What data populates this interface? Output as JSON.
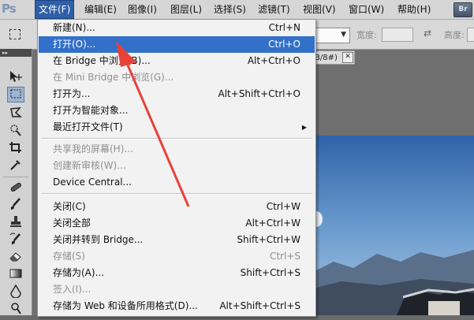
{
  "app": {
    "logo": "Ps",
    "bridge_button": "Br"
  },
  "menubar": {
    "items": [
      {
        "label": "文件(F)",
        "active": true
      },
      {
        "label": "编辑(E)"
      },
      {
        "label": "图像(I)"
      },
      {
        "label": "图层(L)"
      },
      {
        "label": "选择(S)"
      },
      {
        "label": "滤镜(T)"
      },
      {
        "label": "视图(V)"
      },
      {
        "label": "窗口(W)"
      },
      {
        "label": "帮助(H)"
      }
    ]
  },
  "options_bar": {
    "width_label": "宽度:",
    "height_label": "高度:",
    "swap_icon": "⇄",
    "dropdown_arrow": "▼"
  },
  "document": {
    "tab_title": "B/8#)",
    "close_glyph": "✕"
  },
  "toolbar": {
    "collapse_glyph": "▸▸"
  },
  "file_menu": {
    "items": [
      {
        "label": "新建(N)...",
        "shortcut": "Ctrl+N"
      },
      {
        "label": "打开(O)...",
        "shortcut": "Ctrl+O",
        "highlighted": true
      },
      {
        "label": "在 Bridge 中浏览(B)...",
        "shortcut": "Alt+Ctrl+O"
      },
      {
        "label": "在 Mini Bridge 中浏览(G)...",
        "shortcut": "",
        "disabled": true
      },
      {
        "label": "打开为...",
        "shortcut": "Alt+Shift+Ctrl+O"
      },
      {
        "label": "打开为智能对象...",
        "shortcut": ""
      },
      {
        "label": "最近打开文件(T)",
        "shortcut": "",
        "submenu": true
      },
      {
        "label": "共享我的屏幕(H)...",
        "shortcut": "",
        "disabled": true
      },
      {
        "label": "创建新审核(W)...",
        "shortcut": "",
        "disabled": true
      },
      {
        "label": "Device Central...",
        "shortcut": ""
      },
      {
        "label": "关闭(C)",
        "shortcut": "Ctrl+W"
      },
      {
        "label": "关闭全部",
        "shortcut": "Alt+Ctrl+W"
      },
      {
        "label": "关闭并转到 Bridge...",
        "shortcut": "Shift+Ctrl+W"
      },
      {
        "label": "存储(S)",
        "shortcut": "Ctrl+S",
        "disabled": true
      },
      {
        "label": "存储为(A)...",
        "shortcut": "Shift+Ctrl+S"
      },
      {
        "label": "签入(I)...",
        "shortcut": "",
        "disabled": true
      },
      {
        "label": "存储为 Web 和设备所用格式(D)...",
        "shortcut": "Alt+Shift+Ctrl+S"
      }
    ],
    "submenu_arrow": "▶"
  },
  "colors": {
    "menu_highlight": "#3370c9",
    "annotation_arrow": "#e8413a"
  }
}
